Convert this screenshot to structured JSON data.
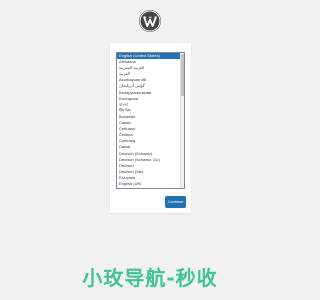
{
  "logo": {
    "icon": "wordpress-logo-icon",
    "color": "#464646"
  },
  "language_select": {
    "selected": "English (United States)",
    "options": [
      "English (United States)",
      "Afrikaans",
      "العربية المغربية",
      "العربية",
      "Azərbaycan dili",
      "گؤنئی آذربایجان",
      "Беларуская мова",
      "Български",
      "বাংলা",
      "བོད་ཡིག",
      "Bosanski",
      "Català",
      "Cebuano",
      "Čeština",
      "Cymraeg",
      "Dansk",
      "Deutsch (Schweiz)",
      "Deutsch (Schweiz, Du)",
      "Deutsch",
      "Deutsch (Sie)",
      "Ελληνικά",
      "English (UK)"
    ]
  },
  "continue_button": {
    "label": "Continue",
    "color": "#2271b1"
  },
  "watermark": {
    "text": "小玫导航-秒收"
  },
  "colors": {
    "background": "#f1f1f1",
    "accent": "#2271b1"
  }
}
